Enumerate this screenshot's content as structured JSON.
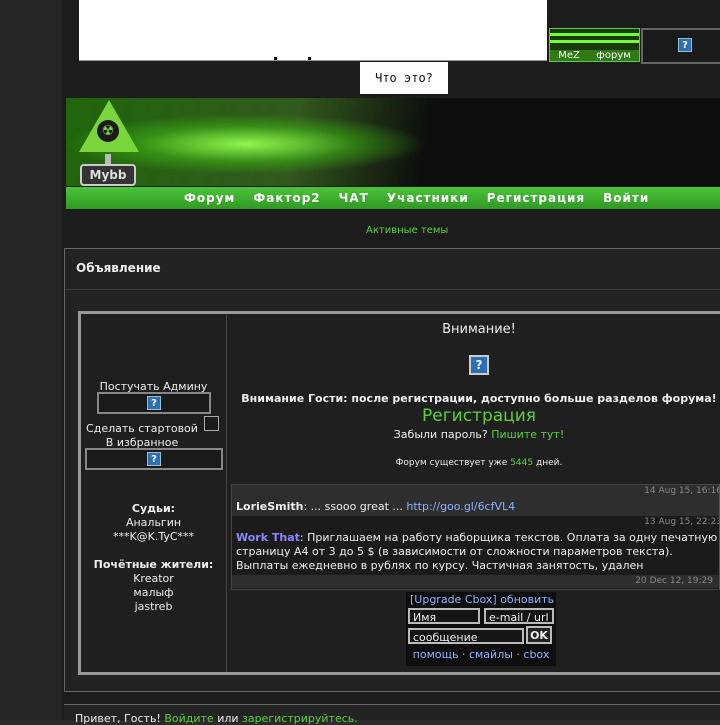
{
  "top": {
    "mini_banner_left": "MeZ",
    "mini_banner_right": "форум",
    "whatis_label": "Что это?",
    "q_icon": "?"
  },
  "logo": {
    "plate": "Mybb",
    "symbol": "☢"
  },
  "nav": {
    "items": [
      "Форум",
      "Фактор2",
      "ЧАТ",
      "Участники",
      "Регистрация",
      "Войти"
    ]
  },
  "active_topics": "Активные темы",
  "announcement": {
    "title": "Объявление",
    "left": {
      "knock_admin": "Постучать Админу",
      "make_start": "Сделать стартовой",
      "favorites": "В избранное",
      "judges_title": "Судьи:",
      "judges": [
        "Анальгин",
        "***K@K.TyC***"
      ],
      "honored_title": "Почётные жители:",
      "honored": [
        "Kreator",
        "малыф",
        "jastreb"
      ]
    },
    "right": {
      "attention": "Внимание!",
      "guest_notice": "Внимание Гости: после регистрации, доступно больше разделов форума!",
      "register": "Регистрация",
      "forgot_prefix": "Забыли пароль?",
      "forgot_link": "Пишите тут!",
      "exists_prefix": "Форум существует уже",
      "exists_days": "5445",
      "exists_suffix": "дней."
    }
  },
  "cbox": {
    "messages": [
      {
        "time": "14 Aug 15, 16:16",
        "author": "LorieSmith",
        "text": ": ... ssooo great ... ",
        "link": "http://goo.gl/6cfVL4"
      },
      {
        "time": "13 Aug 15, 22:23",
        "author": "Work That",
        "text": ": Приглашаем на работу наборщика текстов. Оплата за одну печатную страницу А4 от 3 до 5 $ (в зависимости от сложности параметров текста). Выплаты ежедневно в рублях по курсу. Частичная занятость, удален"
      },
      {
        "time": "20 Dec 12, 19:29"
      }
    ],
    "upgrade": "[Upgrade Cbox]",
    "refresh": "обновить",
    "name_placeholder": "Имя",
    "email_placeholder": "e-mail / url",
    "message_placeholder": "сообщение",
    "ok": "OK",
    "help": "помощь",
    "smilies": "смайлы",
    "cbox": "cbox"
  },
  "footer": {
    "greeting": "Привет, Гость!",
    "login": "Войдите",
    "or": "или",
    "register": "зарегистрируйтесь."
  }
}
